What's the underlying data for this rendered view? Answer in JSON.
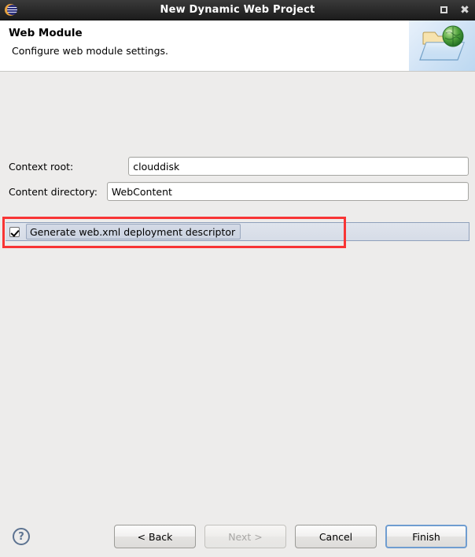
{
  "window": {
    "title": "New Dynamic Web Project",
    "icon": "eclipse-globe-icon",
    "maximize_label": "Maximize",
    "close_label": "Close"
  },
  "header": {
    "title": "Web Module",
    "subtitle": "Configure web module settings.",
    "art_icon": "folder-globe-icon"
  },
  "form": {
    "context_root": {
      "label": "Context root:",
      "value": "clouddisk",
      "placeholder": ""
    },
    "content_directory": {
      "label": "Content directory:",
      "value": "WebContent",
      "placeholder": ""
    },
    "generate_webxml": {
      "label": "Generate web.xml deployment descriptor",
      "checked": true
    }
  },
  "annotation": {
    "color": "#f83535",
    "target": "generate-webxml-checkbox-row"
  },
  "footer": {
    "help_label": "?",
    "back_label": "< Back",
    "next_label": "Next >",
    "cancel_label": "Cancel",
    "finish_label": "Finish",
    "next_enabled": false,
    "finish_is_default": true
  },
  "colors": {
    "body_background": "#edeceb",
    "titlebar": "#2c2c2c",
    "selection_band": "#d6dce7",
    "selection_border": "#8fa0bb",
    "focus_border": "#6f9dd0",
    "help_icon": "#5d7391"
  }
}
